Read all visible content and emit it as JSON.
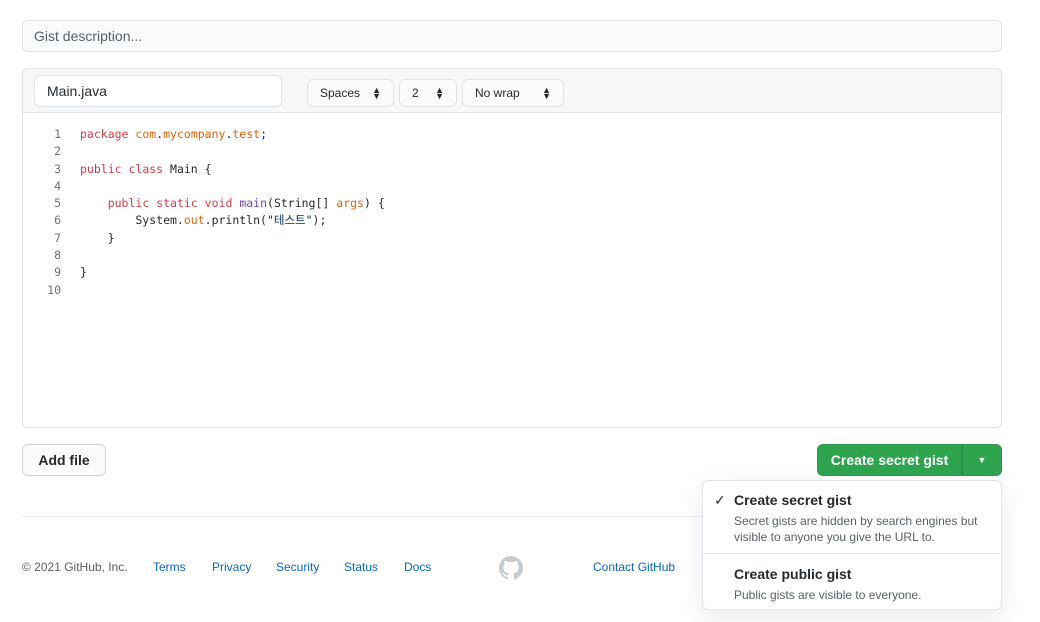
{
  "description": {
    "placeholder": "Gist description..."
  },
  "file": {
    "filename": "Main.java",
    "indent_mode": "Spaces",
    "indent_size": "2",
    "wrap_mode": "No wrap",
    "lines": [
      {
        "n": "1",
        "text": "package com.mycompany.test;"
      },
      {
        "n": "2",
        "text": ""
      },
      {
        "n": "3",
        "text": "public class Main {"
      },
      {
        "n": "4",
        "text": ""
      },
      {
        "n": "5",
        "text": "    public static void main(String[] args) {"
      },
      {
        "n": "6",
        "text": "        System.out.println(\"테스트\");"
      },
      {
        "n": "7",
        "text": "    }"
      },
      {
        "n": "8",
        "text": ""
      },
      {
        "n": "9",
        "text": "}"
      },
      {
        "n": "10",
        "text": ""
      }
    ]
  },
  "actions": {
    "add_file": "Add file",
    "create": "Create secret gist"
  },
  "dropdown": {
    "secret_title": "Create secret gist",
    "secret_desc": "Secret gists are hidden by search engines but visible to anyone you give the URL to.",
    "public_title": "Create public gist",
    "public_desc": "Public gists are visible to everyone."
  },
  "footer": {
    "copyright": "© 2021 GitHub, Inc.",
    "links": [
      "Terms",
      "Privacy",
      "Security",
      "Status",
      "Docs",
      "Contact GitHub"
    ]
  }
}
